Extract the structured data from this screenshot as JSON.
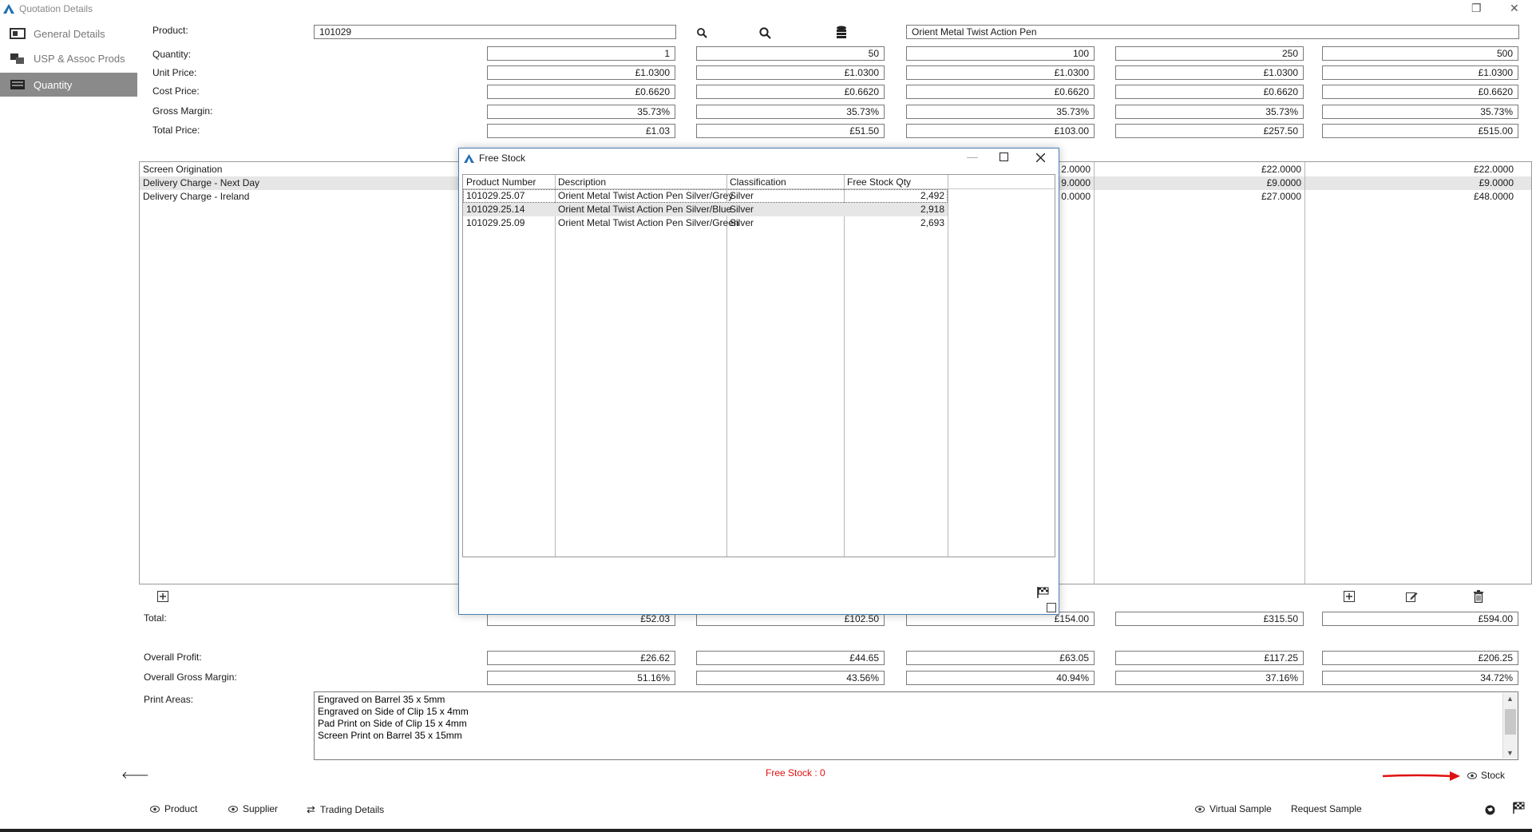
{
  "window": {
    "title": "Quotation Details",
    "restore_glyph": "❐",
    "close_glyph": "✕"
  },
  "nav": [
    {
      "label": "General Details"
    },
    {
      "label": "USP & Assoc Prods"
    },
    {
      "label": "Quantity"
    }
  ],
  "product": {
    "label": "Product:",
    "code": "101029",
    "name": "Orient Metal Twist Action Pen"
  },
  "pricing": {
    "quantity_label": "Quantity:",
    "unit_price_label": "Unit Price:",
    "cost_price_label": "Cost Price:",
    "gross_margin_label": "Gross Margin:",
    "total_price_label": "Total Price:",
    "columns": [
      {
        "qty": "1",
        "unit": "£1.0300",
        "cost": "£0.6620",
        "margin": "35.73%",
        "total": "£1.03"
      },
      {
        "qty": "50",
        "unit": "£1.0300",
        "cost": "£0.6620",
        "margin": "35.73%",
        "total": "£51.50"
      },
      {
        "qty": "100",
        "unit": "£1.0300",
        "cost": "£0.6620",
        "margin": "35.73%",
        "total": "£103.00"
      },
      {
        "qty": "250",
        "unit": "£1.0300",
        "cost": "£0.6620",
        "margin": "35.73%",
        "total": "£257.50"
      },
      {
        "qty": "500",
        "unit": "£1.0300",
        "cost": "£0.6620",
        "margin": "35.73%",
        "total": "£515.00"
      }
    ]
  },
  "charges": {
    "rows": [
      {
        "name": "Screen Origination",
        "col3": "2.0000",
        "col4": "£22.0000",
        "col5": "£22.0000"
      },
      {
        "name": "Delivery Charge - Next Day",
        "col3": "9.0000",
        "col4": "£9.0000",
        "col5": "£9.0000"
      },
      {
        "name": "Delivery Charge - Ireland",
        "col3": "0.0000",
        "col4": "£27.0000",
        "col5": "£48.0000"
      }
    ]
  },
  "totals": {
    "total_label": "Total:",
    "overall_profit_label": "Overall Profit:",
    "overall_gm_label": "Overall Gross Margin:",
    "columns": [
      {
        "total": "£52.03",
        "profit": "£26.62",
        "gm": "51.16%"
      },
      {
        "total": "£102.50",
        "profit": "£44.65",
        "gm": "43.56%"
      },
      {
        "total": "£154.00",
        "profit": "£63.05",
        "gm": "40.94%"
      },
      {
        "total": "£315.50",
        "profit": "£117.25",
        "gm": "37.16%"
      },
      {
        "total": "£594.00",
        "profit": "£206.25",
        "gm": "34.72%"
      }
    ]
  },
  "print_areas": {
    "label": "Print Areas:",
    "text": "Engraved on Barrel 35 x 5mm\nEngraved on Side of Clip 15 x 4mm\nPad Print on Side of Clip 15 x 4mm\nScreen Print on Barrel 35 x 15mm"
  },
  "status": {
    "free_stock": "Free Stock : 0",
    "stock_button": "Stock",
    "arrow_color": "#e01010"
  },
  "footer": {
    "product": "Product",
    "supplier": "Supplier",
    "trading": "Trading Details",
    "virtual_sample": "Virtual Sample",
    "request_sample": "Request Sample"
  },
  "modal": {
    "title": "Free Stock",
    "headers": [
      "Product Number",
      "Description",
      "Classification",
      "Free Stock Qty"
    ],
    "rows": [
      [
        "101029.25.07",
        "Orient Metal Twist Action Pen Silver/Grey",
        "Silver",
        "2,492"
      ],
      [
        "101029.25.14",
        "Orient Metal Twist Action Pen Silver/Blue",
        "Silver",
        "2,918"
      ],
      [
        "101029.25.09",
        "Orient Metal Twist Action Pen Silver/Green",
        "Silver",
        "2,693"
      ]
    ]
  },
  "colors": {
    "accent": "#1f6fb2",
    "nav_active": "#8a8a8a",
    "red": "#e01010"
  }
}
